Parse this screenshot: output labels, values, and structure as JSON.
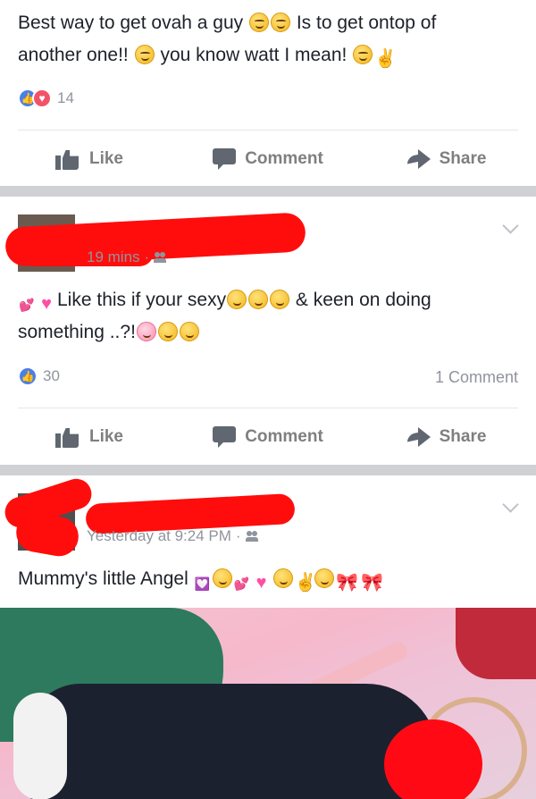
{
  "posts": [
    {
      "text_part1": "Best way to get ovah a guy ",
      "text_part2": " Is to get ontop of",
      "text_part3": "another one!! ",
      "text_part4": " you know watt I mean! ",
      "reaction_count": "14",
      "comments": "",
      "actions": {
        "like": "Like",
        "comment": "Comment",
        "share": "Share"
      }
    },
    {
      "time": "19 mins",
      "text_part1": "Like this if your sexy",
      "text_part2": " & keen on doing",
      "text_part3": "something ..?!",
      "reaction_count": "30",
      "comments": "1 Comment",
      "actions": {
        "like": "Like",
        "comment": "Comment",
        "share": "Share"
      }
    },
    {
      "time": "Yesterday at 9:24 PM",
      "text": "Mummy's little Angel",
      "actions": {}
    }
  ],
  "meta_separator": "·",
  "icons": {
    "like": "like-icon",
    "comment": "comment-icon",
    "share": "share-icon",
    "friends": "friends-icon",
    "chevron": "chevron-down-icon"
  },
  "colors": {
    "like_blue": "#4a7fe8",
    "love_red": "#f25268",
    "redaction": "#ff0d0d",
    "separator": "#d0d1d5"
  }
}
